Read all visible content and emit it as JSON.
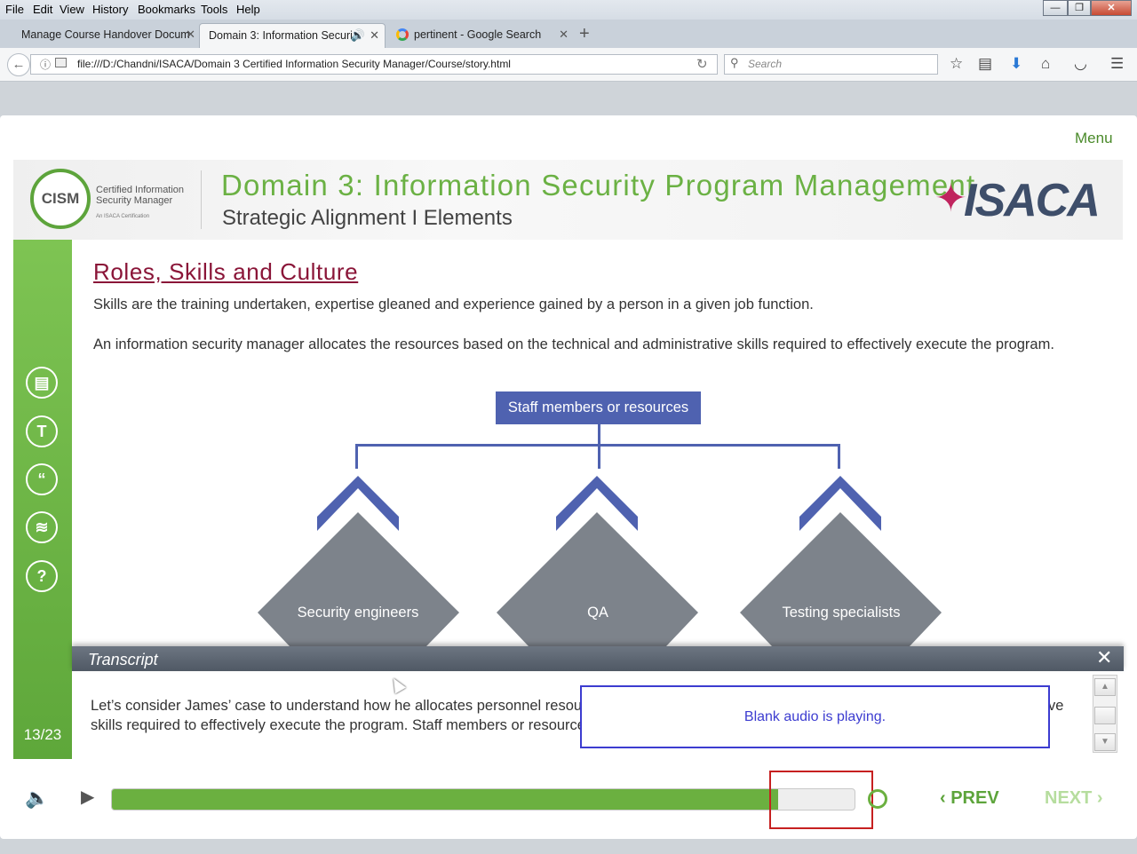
{
  "browser": {
    "menu": [
      "File",
      "Edit",
      "View",
      "History",
      "Bookmarks",
      "Tools",
      "Help"
    ],
    "tabs": [
      {
        "label": "Manage Course Handover Docum"
      },
      {
        "label": "Domain 3: Information Securi"
      },
      {
        "label": "pertinent - Google Search"
      }
    ],
    "new_tab": "+",
    "url": "file:///D:/Chandni/ISACA/Domain 3 Certified Information Security Manager/Course/story.html",
    "search_placeholder": "Search"
  },
  "player": {
    "menu_label": "Menu",
    "header": {
      "cism_logo": "CISM",
      "cism_text": "Certified Information Security Manager",
      "cism_sub": "An ISACA Certification",
      "title": "Domain 3: Information Security Program Management",
      "subtitle": "Strategic Alignment I Elements",
      "isaca_logo": "ISACA"
    },
    "sidebar": {
      "buttons": [
        "notes-icon",
        "text-icon",
        "quote-icon",
        "layers-icon",
        "help-icon"
      ],
      "text_button_glyph": "T",
      "quote_button_glyph": "“",
      "help_button_glyph": "?",
      "slide_counter": "13/23"
    },
    "content": {
      "heading": "Roles, Skills and Culture",
      "para1": "Skills are the training undertaken, expertise gleaned and experience gained by a person in a given job function.",
      "para2": "An information security manager allocates the resources based on the technical and administrative skills required to effectively execute the program.",
      "org_top": "Staff members or resources",
      "roles": [
        "Security engineers",
        "QA",
        "Testing specialists"
      ]
    },
    "transcript": {
      "title": "Transcript",
      "close": "✕",
      "line1": "Let’s consider James’ case to understand how he allocates personnel resou",
      "line1_tail": "ve",
      "line2": "skills required to effectively execute the program. Staff members or resource"
    },
    "audio_notice": "Blank audio is playing.",
    "controls": {
      "progress": 0.897,
      "prev": "PREV",
      "next": "NEXT"
    },
    "colors": {
      "accent_green": "#6bb040",
      "heading": "#8a1538",
      "org_blue": "#4f62b0",
      "diamond_gray": "#7d838b"
    }
  }
}
